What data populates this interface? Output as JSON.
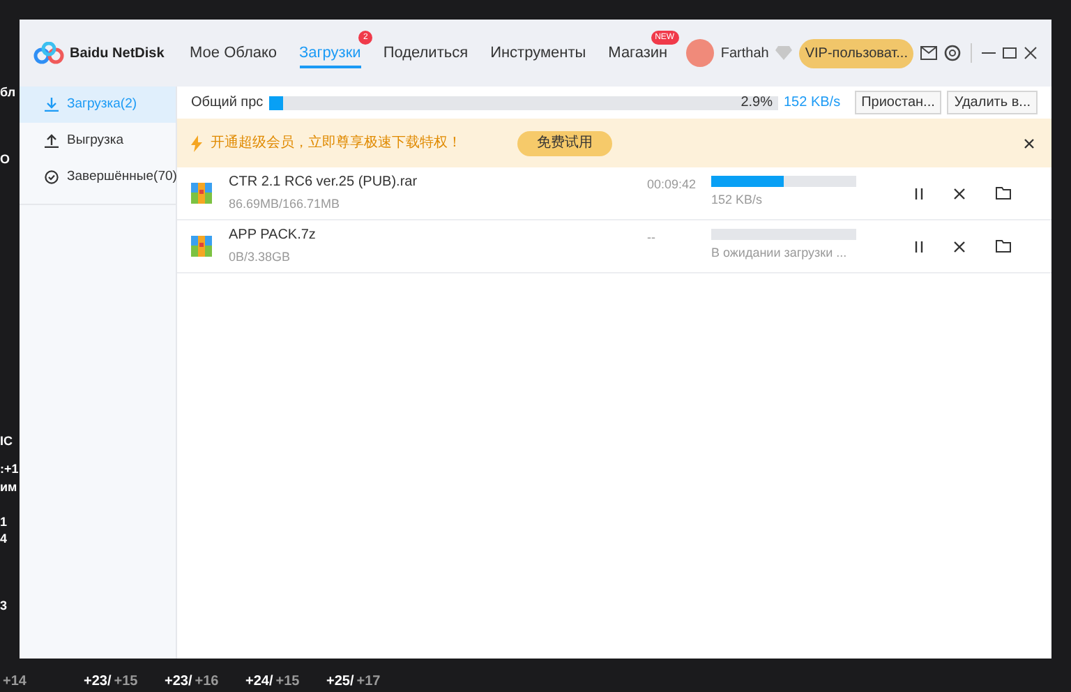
{
  "desktop": {
    "edge_texts": [
      "бл",
      "О",
      "IC",
      ":+1",
      "им",
      "1",
      "4",
      "3"
    ],
    "weather": [
      {
        "low": "+14"
      },
      {
        "high": "+23/",
        "low": "+15"
      },
      {
        "high": "+23/",
        "low": "+16"
      },
      {
        "high": "+24/",
        "low": "+15"
      },
      {
        "high": "+25/",
        "low": "+17"
      }
    ]
  },
  "window": {
    "logo": "Baidu NetDisk",
    "tabs": [
      {
        "label": "Мое Облако",
        "selected": false
      },
      {
        "label": "Загрузки",
        "selected": true,
        "badge": "2"
      },
      {
        "label": "Поделиться",
        "selected": false
      },
      {
        "label": "Инструменты",
        "selected": false
      },
      {
        "label": "Магазин",
        "selected": false,
        "badge": "NEW"
      }
    ],
    "user": {
      "name": "Farthah",
      "vip": "VIP-пользоват..."
    }
  },
  "sidebar": {
    "items": [
      {
        "label": "Загрузка(2)",
        "kind": "download",
        "selected": true
      },
      {
        "label": "Выгрузка",
        "kind": "upload",
        "selected": false
      },
      {
        "label": "Завершённые(70)",
        "kind": "done",
        "selected": false
      }
    ]
  },
  "total": {
    "label": "Общий прс",
    "level": 0.029,
    "percent": "2.9%",
    "speed": "152 KB/s",
    "buttons": [
      "Приостан...",
      "Удалить в..."
    ]
  },
  "banner": {
    "text": "开通超级会员，立即尊享极速下载特权！",
    "button": "免费试用"
  },
  "downloads": [
    {
      "name": "CTR 2.1 RC6 ver.25 (PUB).rar",
      "size": "86.69MB/166.71MB",
      "time": "00:09:42",
      "level": 0.5,
      "status": "152 KB/s"
    },
    {
      "name": "APP PACK.7z",
      "size": "0B/3.38GB",
      "time": "--",
      "status": "В ожидании загрузки ..."
    }
  ]
}
